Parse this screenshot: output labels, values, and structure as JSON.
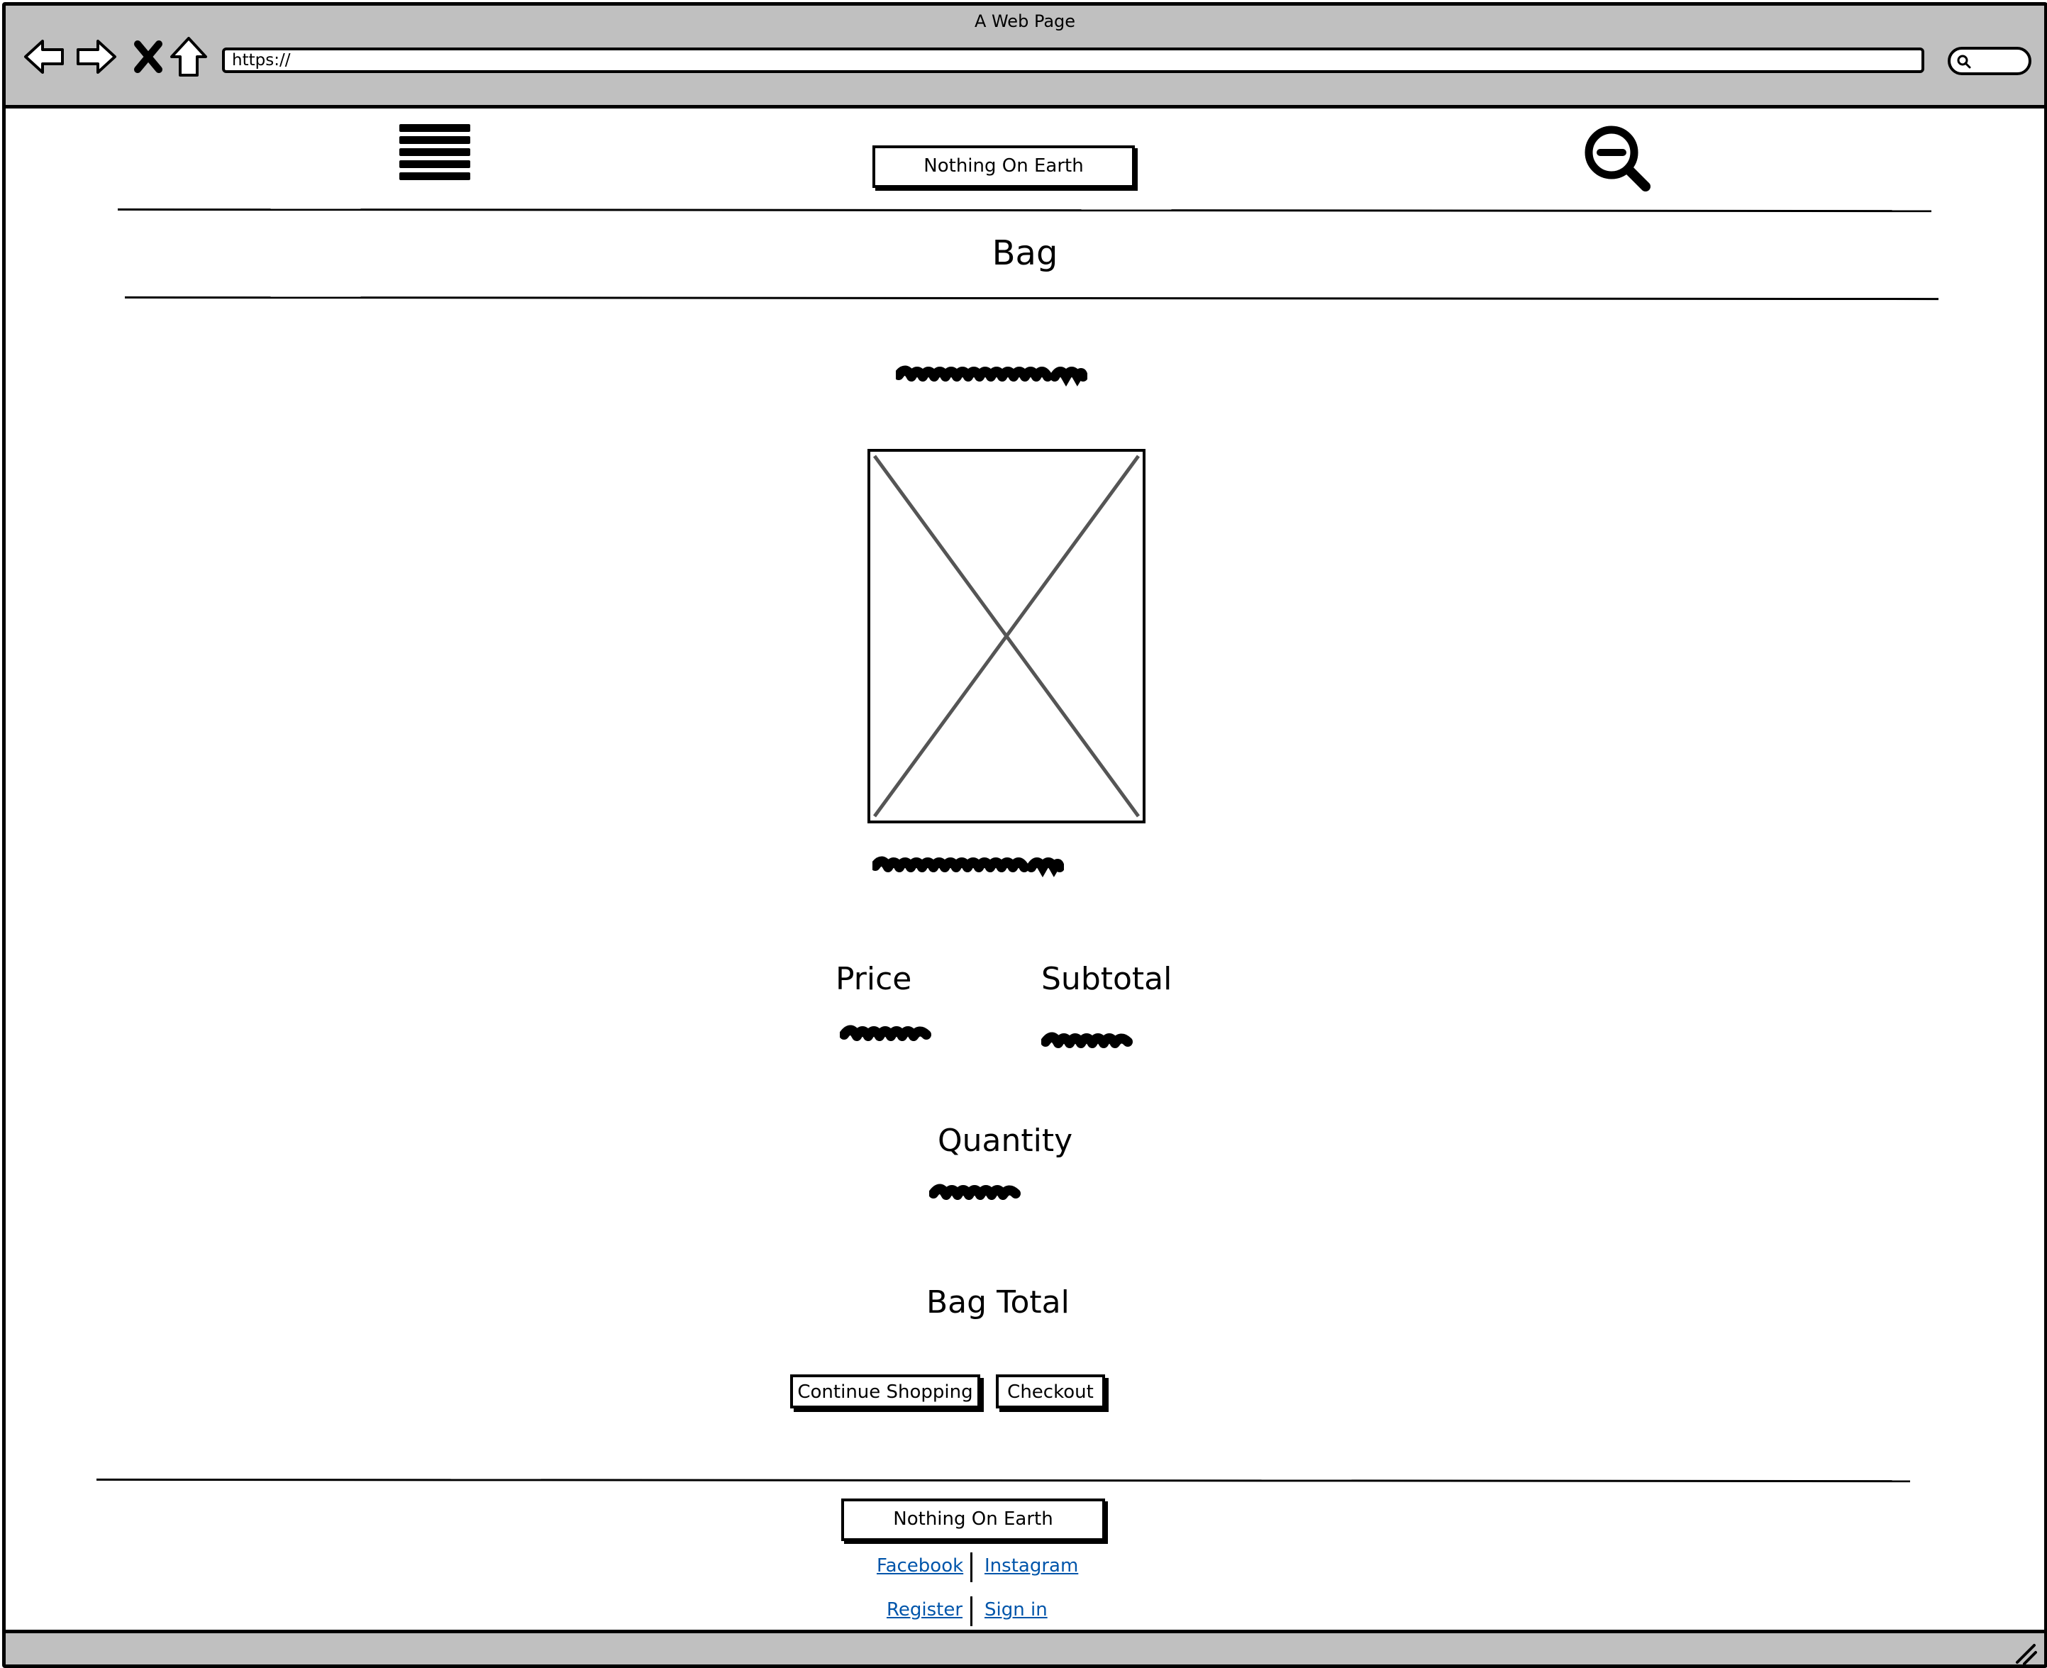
{
  "browser": {
    "window_title": "A Web Page",
    "url": "https://"
  },
  "header": {
    "logo_text": "Nothing On Earth"
  },
  "main": {
    "page_title": "Bag",
    "price_label": "Price",
    "subtotal_label": "Subtotal",
    "quantity_label": "Quantity",
    "bag_total_label": "Bag Total",
    "continue_button": "Continue Shopping",
    "checkout_button": "Checkout"
  },
  "footer": {
    "logo_text": "Nothing On Earth",
    "links": {
      "facebook": "Facebook",
      "instagram": "Instagram",
      "register": "Register",
      "sign_in": "Sign in"
    }
  },
  "icons": {
    "back": "back-arrow-icon",
    "forward": "forward-arrow-icon",
    "stop": "close-icon",
    "home": "home-icon",
    "menu": "hamburger-menu-icon",
    "zoom": "zoom-out-icon",
    "search": "search-icon",
    "resize": "resize-grip-icon"
  }
}
